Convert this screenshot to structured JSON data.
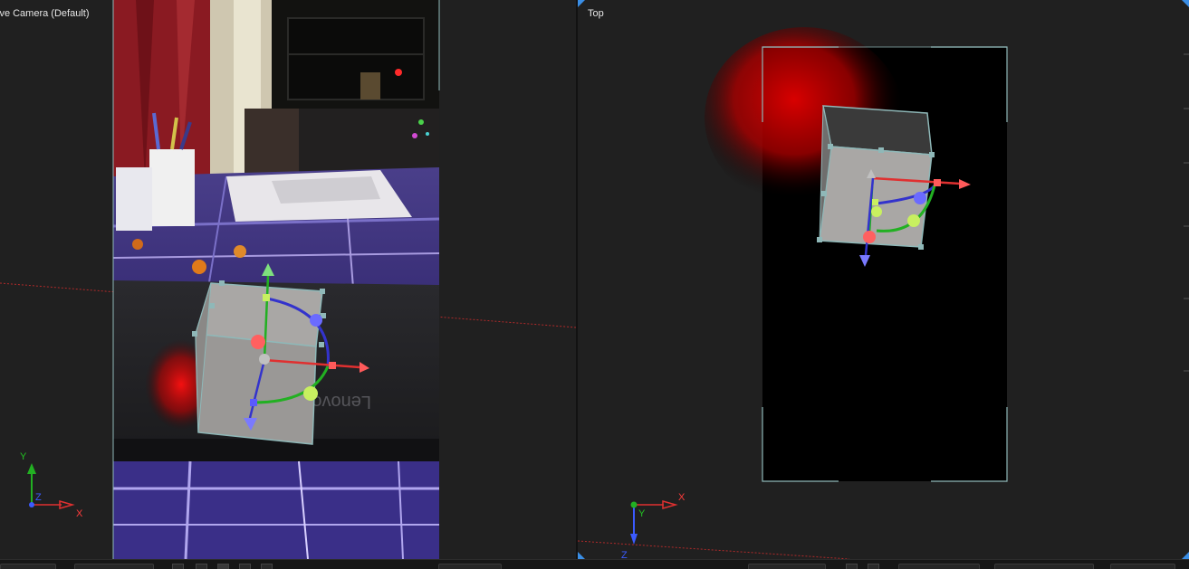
{
  "viewports": {
    "left": {
      "title": "ive Camera (Default)",
      "gizmo": {
        "x_label": "X",
        "y_label": "Y",
        "z_label": "Z"
      }
    },
    "right": {
      "title": "Top",
      "gizmo": {
        "x_label": "X",
        "y_label": "Y",
        "z_label": "Z"
      }
    }
  },
  "colors": {
    "panel_bg": "#202020",
    "axis_x": "#ff3b3b",
    "axis_y": "#22c022",
    "axis_z": "#3b5bff",
    "accent_corner": "#3a8ee6",
    "bbox": "#8fb8b8"
  },
  "icons": {
    "gizmo_translate_x": "arrow-right-icon",
    "gizmo_translate_y": "arrow-up-icon",
    "gizmo_translate_z": "arrow-down-icon"
  }
}
